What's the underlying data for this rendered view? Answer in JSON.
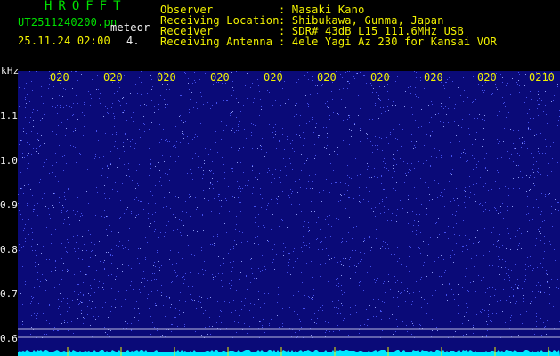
{
  "header": {
    "logo": "HROFFT",
    "filename": "UT2511240200.pn",
    "meteor_label": "meteor",
    "datetime": "25.11.24 02:00",
    "count": "4.",
    "info": [
      {
        "label": "Observer",
        "value": ": Masaki Kano"
      },
      {
        "label": "Receiving Location",
        "value": ": Shibukawa, Gunma, Japan"
      },
      {
        "label": "Receiver",
        "value": ": SDR# 43dB L15 111.6MHz USB"
      },
      {
        "label": "Receiving Antenna",
        "value": ": 4ele Yagi Az 230 for Kansai VOR"
      }
    ]
  },
  "axes": {
    "y_unit": "kHz",
    "y_ticks": [
      "1.1",
      "1.0",
      "0.9",
      "0.8",
      "0.7",
      "0.6"
    ],
    "x_ticks": [
      "020",
      "020",
      "020",
      "020",
      "020",
      "020",
      "020",
      "020",
      "020",
      "0210"
    ]
  },
  "colors": {
    "background": "#000000",
    "spectrogram": "#0a0a78",
    "noise": "#4d5cff",
    "baseline": "#00e8ff",
    "axis_text": "#f2f200",
    "logo": "#00e000"
  }
}
